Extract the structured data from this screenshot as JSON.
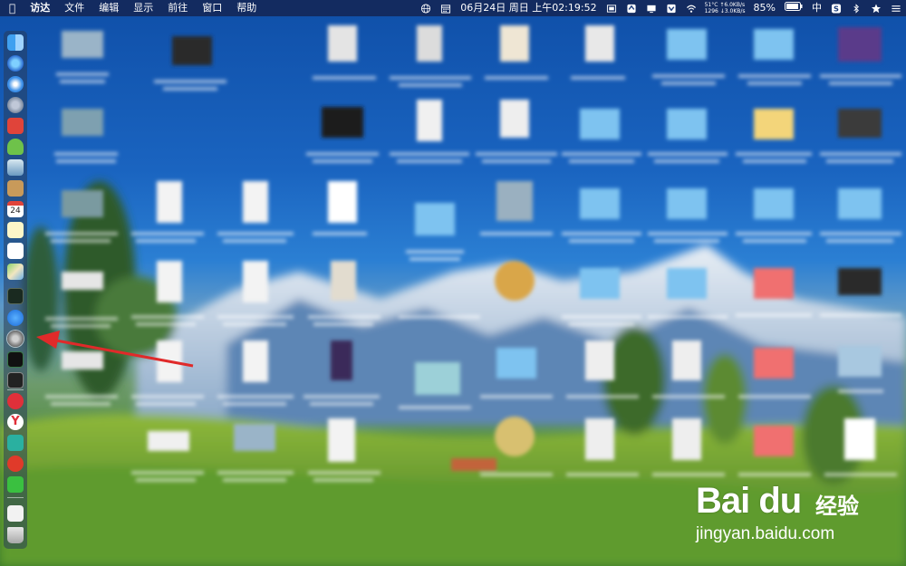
{
  "menubar": {
    "apple_icon": "apple-icon",
    "items": [
      "访达",
      "文件",
      "编辑",
      "显示",
      "前往",
      "窗口",
      "帮助"
    ],
    "datetime": "06月24日 周日 上午02:19:52",
    "net_top": "51°C ↑6.0KB/s",
    "net_bottom": "1296 ↓3.0KB/s",
    "battery": "85%",
    "input_method": "中"
  },
  "dock": {
    "calendar_day": "24",
    "items": [
      "finder",
      "siri",
      "safari",
      "launchpad",
      "toolbox",
      "android-studio",
      "preview",
      "notes-pad",
      "calendar",
      "reminders",
      "textedit",
      "maps",
      "terminal-monitor",
      "app-store",
      "system-preferences",
      "activity-monitor",
      "terminal",
      "vivaldi",
      "yandex",
      "airdroid",
      "netease-music",
      "wechat",
      "documents",
      "trash"
    ]
  },
  "watermark": {
    "logo": "Bai du",
    "logo_cn": "经验",
    "url": "jingyan.baidu.com"
  }
}
